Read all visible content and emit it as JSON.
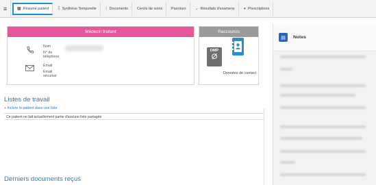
{
  "tabs": [
    {
      "label": "Résumé patient",
      "icon": "grid-icon",
      "active": true
    },
    {
      "label": "Synthèse Temporelle",
      "icon": "timeline-icon"
    },
    {
      "label": "Documents",
      "icon": "document-icon"
    },
    {
      "label": "Cercle de soins",
      "icon": ""
    },
    {
      "label": "Parcours",
      "icon": ""
    },
    {
      "label": "Résultats d'examens",
      "icon": "flask-icon"
    },
    {
      "label": "Prescriptions",
      "icon": "pill-icon"
    }
  ],
  "medecin": {
    "title": "Médecin traitant",
    "nom_label": "Nom",
    "tel_label": "N° de téléphone",
    "email_label": "Email",
    "email_secure_label": "Email sécurisé"
  },
  "raccourcis": {
    "title": "Raccourcis",
    "dmp_label": "DMP",
    "dmp_symbol": "Ø",
    "contact_label": "Données de contact"
  },
  "listes": {
    "heading": "Listes de travail",
    "add_link": "+ Inclure le patient dans une liste",
    "empty_text": "Ce patient ne fait actuellement partie d'aucune liste partagée"
  },
  "documents": {
    "heading": "Derniers documents reçus"
  },
  "notes": {
    "title": "Notes"
  },
  "colors": {
    "accent_pink": "#e9559a",
    "accent_blue": "#1c8fd8",
    "link_blue": "#2a7bbf",
    "grey_header": "#9a9a9a"
  }
}
